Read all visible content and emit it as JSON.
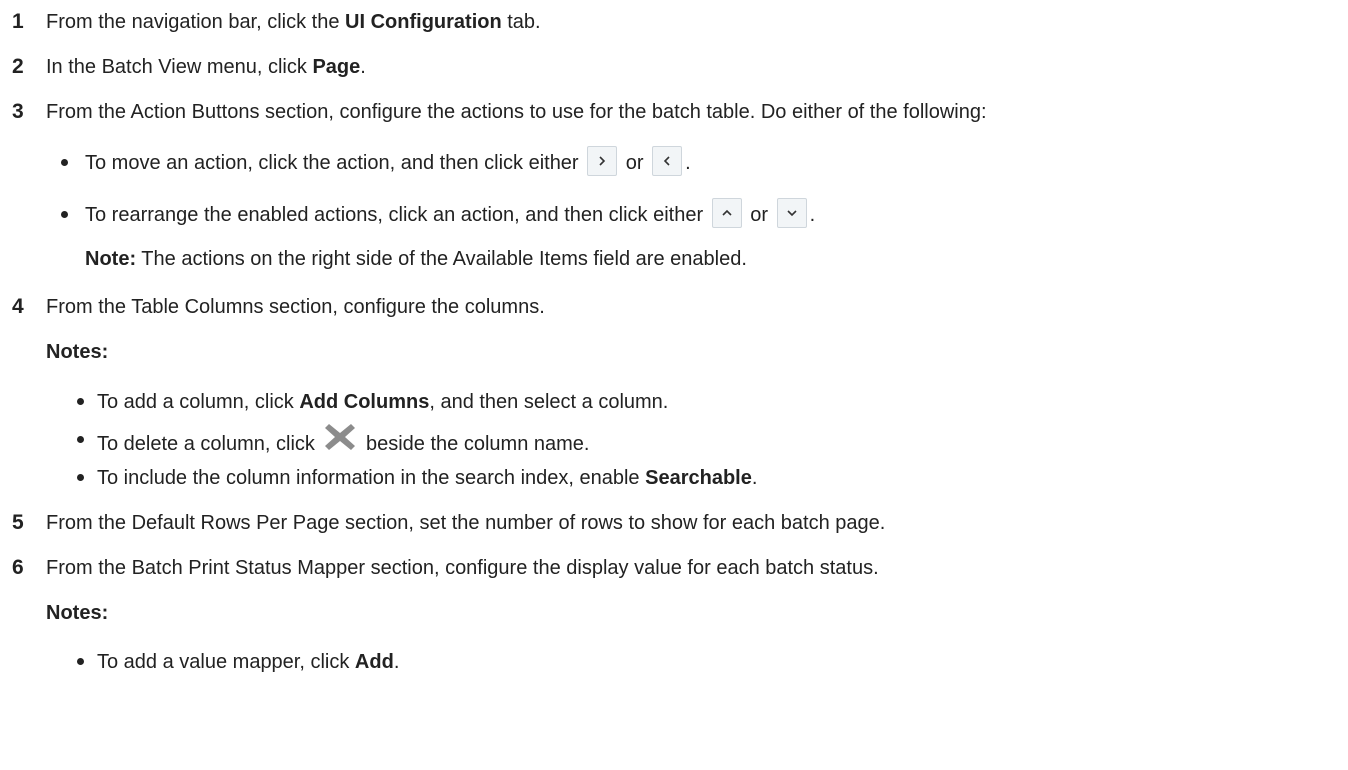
{
  "steps": [
    {
      "num": "1",
      "pre": "From the navigation bar, click the ",
      "bold": "UI Configuration",
      "post": " tab."
    },
    {
      "num": "2",
      "pre": "In the Batch View menu, click ",
      "bold": "Page",
      "post": "."
    },
    {
      "num": "3",
      "text": "From the Action Buttons section, configure the actions to use for the batch table. Do either of the following:"
    },
    {
      "num": "4",
      "text": "From the Table Columns section, configure the columns."
    },
    {
      "num": "5",
      "text": "From the Default Rows Per Page section, set the number of rows to show for each batch page."
    },
    {
      "num": "6",
      "text": "From the Batch Print Status Mapper section, configure the display value for each batch status."
    }
  ],
  "step3": {
    "bullet_move": {
      "pre": "To move an action, click the action, and then click either ",
      "mid": " or ",
      "end": "."
    },
    "bullet_rearrange": {
      "pre": "To rearrange the enabled actions, click an action, and then click either ",
      "mid": " or ",
      "end": "."
    },
    "note": {
      "label": "Note:",
      "text": " The actions on the right side of the Available Items field are enabled."
    }
  },
  "step4": {
    "notes_label": "Notes:",
    "bullets": [
      {
        "pre": "To add a column, click ",
        "bold": "Add Columns",
        "post": ", and then select a column."
      },
      {
        "pre": "To delete a column, click ",
        "post": " beside the column name."
      },
      {
        "pre": "To include the column information in the search index, enable ",
        "bold": "Searchable",
        "post": "."
      }
    ]
  },
  "step6": {
    "notes_label": "Notes:",
    "bullets": [
      {
        "pre": "To add a value mapper, click ",
        "bold": "Add",
        "post": "."
      }
    ]
  },
  "icons": {
    "move_right": "chevron-right-icon",
    "move_left": "chevron-left-icon",
    "move_up": "chevron-up-icon",
    "move_down": "chevron-down-icon",
    "delete": "x-delete-icon"
  },
  "colors": {
    "text": "#222222",
    "button_bg": "#f2f5f7",
    "button_border": "#cfd6dc",
    "delete_icon": "#8c8c8c"
  }
}
